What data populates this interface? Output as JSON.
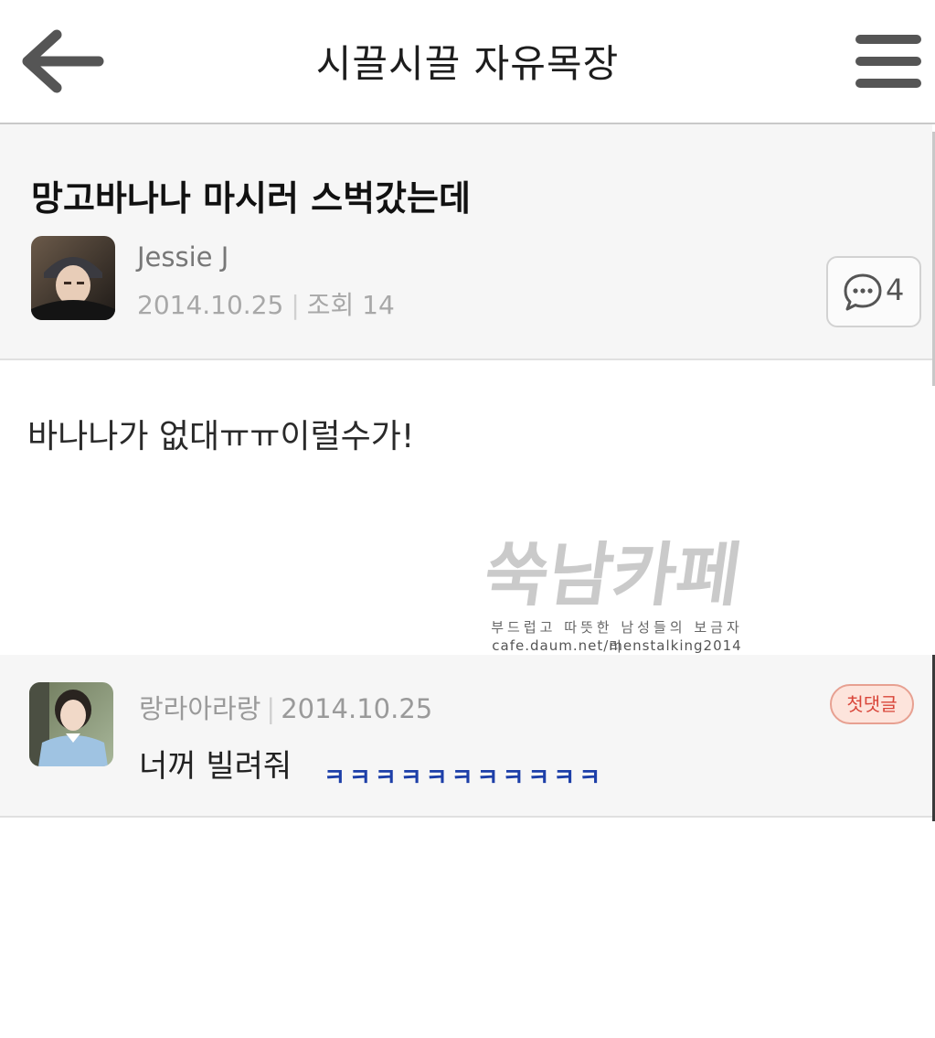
{
  "header": {
    "title": "시끌시끌 자유목장",
    "back_icon": "arrow-left-icon",
    "menu_icon": "hamburger-menu-icon"
  },
  "post": {
    "title": "망고바나나 마시러 스벅갔는데",
    "author": "Jessie J",
    "date": "2014.10.25",
    "views_label": "조회 14",
    "comment_count": "4",
    "body": "바나나가 없대ㅠㅠ이럴수가!"
  },
  "watermark": {
    "logo_text": "쑥남카페",
    "tagline": "부드럽고 따뜻한 남성들의 보금자리",
    "url": "cafe.daum.net/menstalking2014"
  },
  "comment": {
    "author": "랑라아라랑",
    "date": "2014.10.25",
    "badge": "첫댓글",
    "text": "너꺼 빌려줘",
    "laugh": "ㅋㅋㅋㅋㅋㅋㅋㅋㅋㅋㅋ"
  },
  "colors": {
    "badge_bg": "#fde4dc",
    "badge_text": "#d9463a",
    "laugh_text": "#1d3fa8"
  }
}
